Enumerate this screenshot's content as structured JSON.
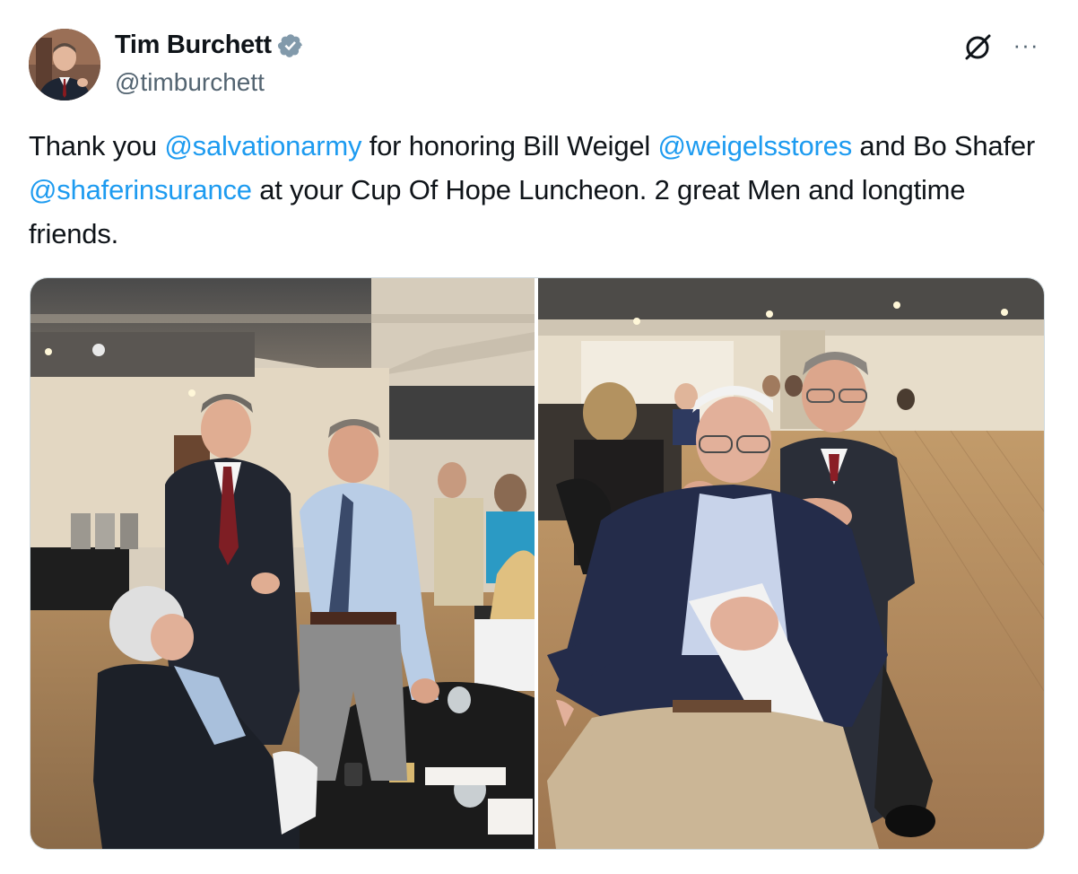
{
  "author": {
    "display_name": "Tim Burchett",
    "handle": "@timburchett",
    "verified": true,
    "verified_color": "#829aab",
    "avatar_icon": "profile-photo"
  },
  "actions": {
    "grok_icon": "grok-icon",
    "more_label": "···"
  },
  "tweet": {
    "segments": [
      {
        "text": "Thank you ",
        "type": "text"
      },
      {
        "text": "@salvationarmy",
        "type": "mention"
      },
      {
        "text": " for honoring Bill Weigel  ",
        "type": "text"
      },
      {
        "text": "@weigelsstores",
        "type": "mention"
      },
      {
        "text": " and Bo Shafer ",
        "type": "text"
      },
      {
        "text": "@shaferinsurance",
        "type": "mention"
      },
      {
        "text": " at your Cup Of Hope Luncheon. 2 great Men and longtime friends.",
        "type": "text"
      }
    ]
  },
  "media": {
    "count": 2,
    "photos": [
      {
        "alt": "Three men talking at a banquet hall luncheon table"
      },
      {
        "alt": "Two men posing together, one seated with napkin, at luncheon"
      }
    ]
  },
  "colors": {
    "text": "#0f1419",
    "secondary": "#536471",
    "link": "#1d9bf0",
    "border": "#cfd9de"
  }
}
